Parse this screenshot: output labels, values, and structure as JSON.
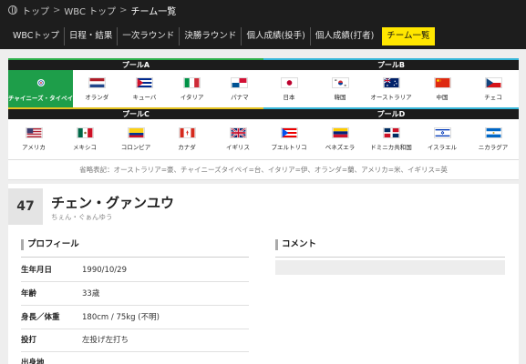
{
  "breadcrumb": [
    "トップ",
    "WBC トップ",
    "チーム一覧"
  ],
  "tabs": [
    "WBCトップ",
    "日程・結果",
    "一次ラウンド",
    "決勝ラウンド",
    "個人成績(投手)",
    "個人成績(打者)",
    "チーム一覧"
  ],
  "active_tab": "チーム一覧",
  "pools": {
    "a": {
      "name": "プールA",
      "teams": [
        "チャイニーズ・タイペイ",
        "オランダ",
        "キューバ",
        "イタリア",
        "パナマ"
      ]
    },
    "b": {
      "name": "プールB",
      "teams": [
        "日本",
        "韓国",
        "オーストラリア",
        "中国",
        "チェコ"
      ]
    },
    "c": {
      "name": "プールC",
      "teams": [
        "アメリカ",
        "メキシコ",
        "コロンビア",
        "カナダ",
        "イギリス"
      ]
    },
    "d": {
      "name": "プールD",
      "teams": [
        "プエルトリコ",
        "ベネズエラ",
        "ドミニカ共和国",
        "イスラエル",
        "ニカラグア"
      ]
    }
  },
  "selected_team": "チャイニーズ・タイペイ",
  "abbreviation_note": "省略表記：オーストラリア=豪、チャイニーズタイペイ=台、イタリア=伊、オランダ=蘭、アメリカ=米、イギリス=英",
  "player": {
    "number": "47",
    "name": "チェン・グァンユウ",
    "kana": "ちぇん・ぐぁんゆう"
  },
  "profile": {
    "title": "プロフィール",
    "rows": [
      {
        "label": "生年月日",
        "value": "1990/10/29"
      },
      {
        "label": "年齢",
        "value": "33歳"
      },
      {
        "label": "身長／体重",
        "value": "180cm / 75kg (不明)"
      },
      {
        "label": "投打",
        "value": "左投げ左打ち"
      },
      {
        "label": "出身地",
        "value": ""
      }
    ]
  },
  "comment": {
    "title": "コメント",
    "body": ""
  },
  "colors": {
    "pool_a_top": "#2db04a",
    "pool_a_bottom": "#e4c21f",
    "pool_b": "#35b6d9",
    "selected": "#1e9e4a",
    "active_tab": "#ffe600"
  },
  "icons": [
    "globe-icon",
    "flag-icons"
  ]
}
